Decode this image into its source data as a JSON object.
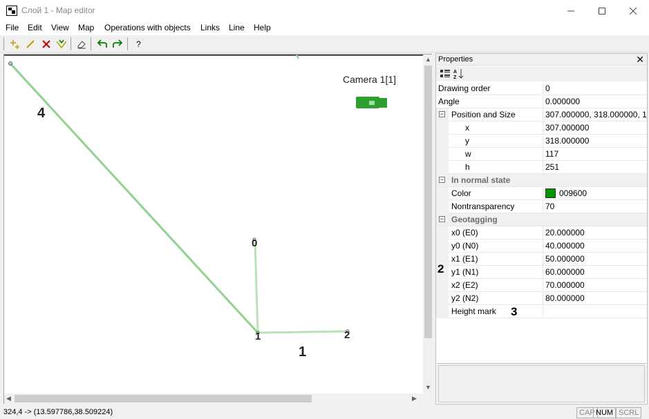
{
  "window": {
    "title": "Слой 1 - Map editor"
  },
  "menu": [
    "File",
    "Edit",
    "View",
    "Map",
    "Operations with objects",
    "Links",
    "Line",
    "Help"
  ],
  "toolbar": {
    "icons": [
      "add-point-icon",
      "draw-line-icon",
      "delete-icon",
      "merge-points-icon",
      "eraser-icon",
      "undo-icon",
      "redo-icon",
      "help-icon"
    ],
    "help_label": "?"
  },
  "map": {
    "camera_label": "Camera 1[1]",
    "line_color": "#8fd18f",
    "camera_color": "#2e9e2e",
    "point_labels": [
      "0",
      "1",
      "2"
    ],
    "annotations": [
      "4",
      "1"
    ]
  },
  "properties": {
    "title": "Properties",
    "close_label": "✕",
    "rows": [
      {
        "name": "Drawing order",
        "value": "0"
      },
      {
        "name": "Angle",
        "value": "0.000000"
      },
      {
        "name": "Position and Size",
        "value": "307.000000, 318.000000, 1..."
      },
      {
        "name": "x",
        "value": "307.000000"
      },
      {
        "name": "y",
        "value": "318.000000"
      },
      {
        "name": "w",
        "value": "117"
      },
      {
        "name": "h",
        "value": "251"
      },
      {
        "name": "In normal state",
        "value": ""
      },
      {
        "name": "Color",
        "value": "009600",
        "swatch": "#009600"
      },
      {
        "name": "Nontransparency",
        "value": "70"
      },
      {
        "name": "Geotagging",
        "value": ""
      },
      {
        "name": "x0 (E0)",
        "value": "20.000000"
      },
      {
        "name": "y0 (N0)",
        "value": "40.000000"
      },
      {
        "name": "x1 (E1)",
        "value": "50.000000"
      },
      {
        "name": "y1 (N1)",
        "value": "60.000000"
      },
      {
        "name": "x2 (E2)",
        "value": "70.000000"
      },
      {
        "name": "y2 (N2)",
        "value": "80.000000"
      },
      {
        "name": "Height mark",
        "value": ""
      }
    ],
    "annotations": [
      "2",
      "3"
    ]
  },
  "status": {
    "coords": "324,4 -> (13.597786,38.509224)",
    "cap": "CAP",
    "num": "NUM",
    "scrl": "SCRL"
  }
}
